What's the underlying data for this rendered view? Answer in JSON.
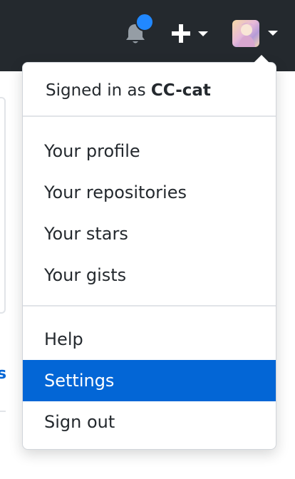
{
  "header": {
    "notifications_icon": "bell-icon",
    "create_icon": "plus-icon",
    "avatar_icon": "user-avatar",
    "background": "#24292e",
    "notification_dot_color": "#2188ff"
  },
  "background_page": {
    "link_fragment": "s"
  },
  "menu": {
    "signed_in_prefix": "Signed in as",
    "username": "CC-cat",
    "group1": [
      {
        "label": "Your profile"
      },
      {
        "label": "Your repositories"
      },
      {
        "label": "Your stars"
      },
      {
        "label": "Your gists"
      }
    ],
    "group2": [
      {
        "label": "Help"
      },
      {
        "label": "Settings",
        "active": true
      },
      {
        "label": "Sign out"
      }
    ],
    "active_color": "#0366d6"
  }
}
